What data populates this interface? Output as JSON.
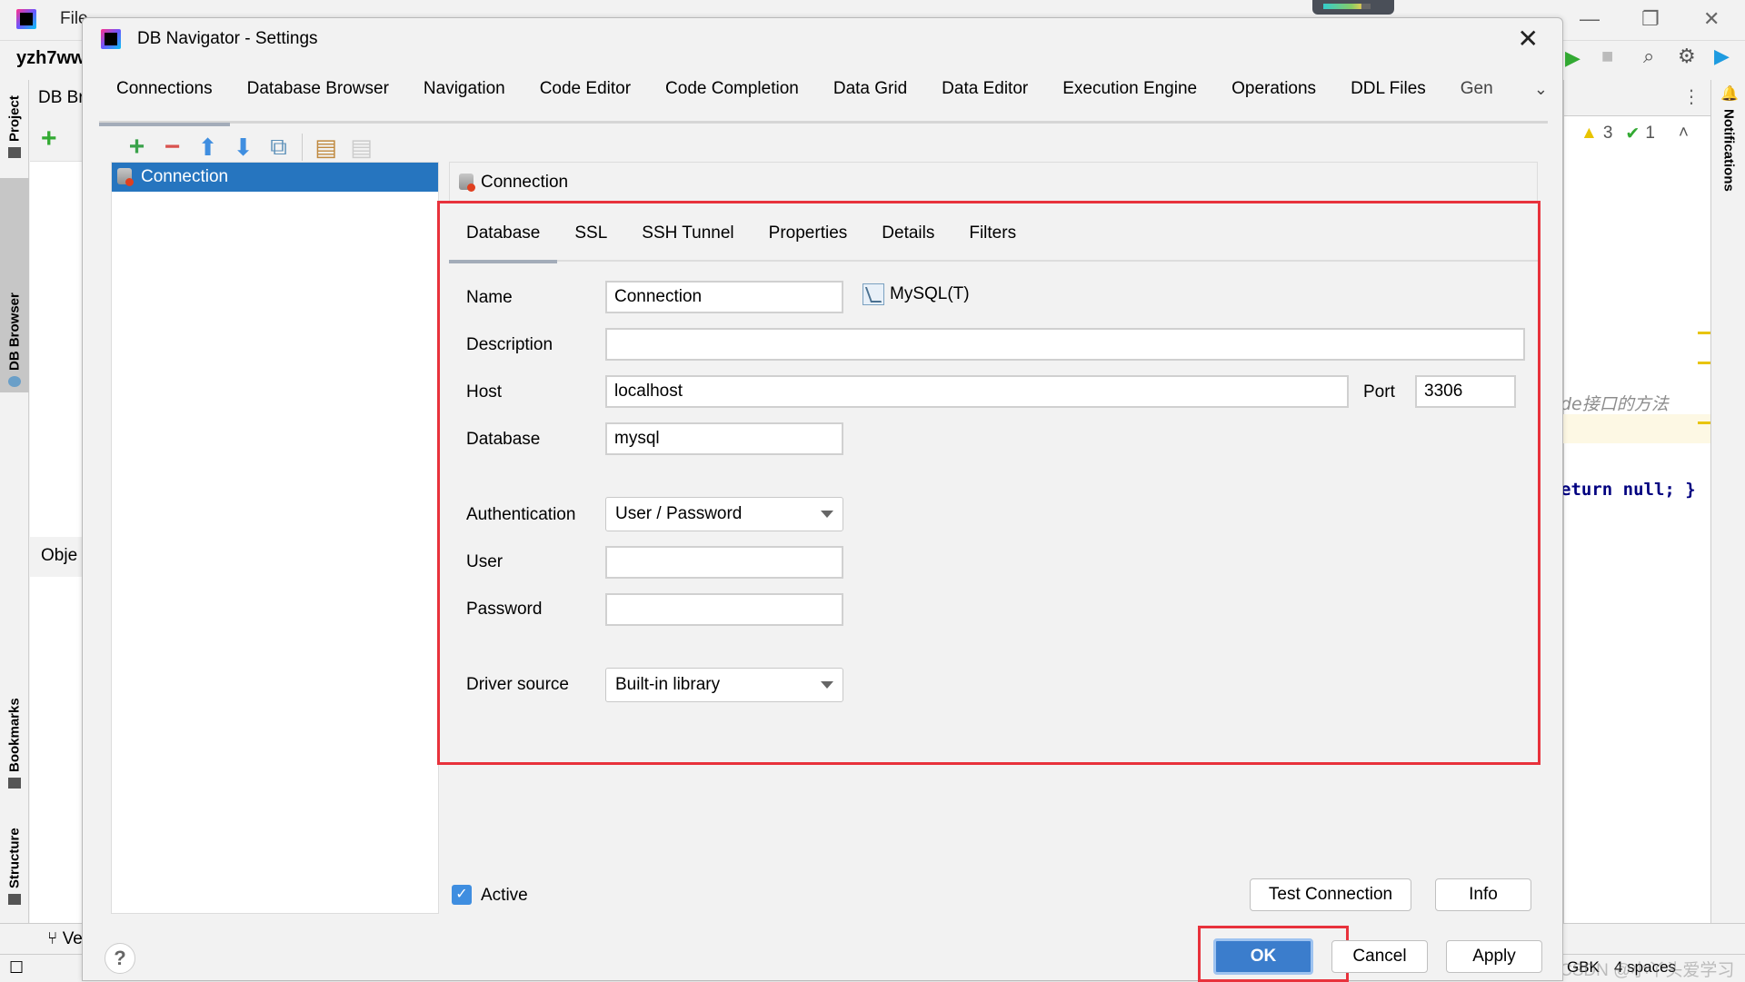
{
  "ide": {
    "menu_visible_first": "File",
    "project_name": "yzh7ww",
    "left_strip_tabs": [
      {
        "label": "Project",
        "icon": "folder-icon",
        "selected": false
      },
      {
        "label": "DB Browser",
        "icon": "db-browser-icon",
        "selected": true
      },
      {
        "label": "Bookmarks",
        "icon": "bookmark-icon",
        "selected": false
      },
      {
        "label": "Structure",
        "icon": "structure-icon",
        "selected": false
      }
    ],
    "db_panel_header": "DB Br",
    "object_panel_header": "Obje",
    "bottom_tab": "Ve",
    "right_strip_tab": "Notifications",
    "inspections": {
      "warnings": "3",
      "ok": "1"
    },
    "code_comment_fragment": "de接口的方法",
    "code_fragment": "eturn null; }",
    "status": {
      "encoding": "GBK",
      "indent": "4 spaces",
      "watermark": "CSDN @小丫头爱学习"
    }
  },
  "dialog": {
    "title": "DB Navigator - Settings",
    "tabs": [
      "Connections",
      "Database Browser",
      "Navigation",
      "Code Editor",
      "Code Completion",
      "Data Grid",
      "Data Editor",
      "Execution Engine",
      "Operations",
      "DDL Files",
      "Gen"
    ],
    "selected_tab": "Connections",
    "toolbar": [
      "add-icon",
      "remove-icon",
      "move-up-icon",
      "move-down-icon",
      "copy-icon",
      "export-icon",
      "import-icon"
    ],
    "connections": [
      {
        "label": "Connection",
        "selected": true
      }
    ],
    "panel_title": "Connection",
    "subtabs": [
      "Database",
      "SSL",
      "SSH Tunnel",
      "Properties",
      "Details",
      "Filters"
    ],
    "selected_subtab": "Database",
    "form": {
      "name_label": "Name",
      "name_value": "Connection",
      "db_type": "MySQL(T)",
      "description_label": "Description",
      "description_value": "",
      "host_label": "Host",
      "host_value": "localhost",
      "port_label": "Port",
      "port_value": "3306",
      "database_label": "Database",
      "database_value": "mysql",
      "authentication_label": "Authentication",
      "authentication_value": "User / Password",
      "user_label": "User",
      "user_value": "",
      "password_label": "Password",
      "password_value": "",
      "driver_source_label": "Driver source",
      "driver_source_value": "Built-in library"
    },
    "active_label": "Active",
    "active_checked": true,
    "buttons": {
      "test_connection": "Test Connection",
      "info": "Info",
      "ok": "OK",
      "cancel": "Cancel",
      "apply": "Apply",
      "help": "?"
    },
    "highlight_color": "#e8323c",
    "accent_color": "#2675bf"
  }
}
